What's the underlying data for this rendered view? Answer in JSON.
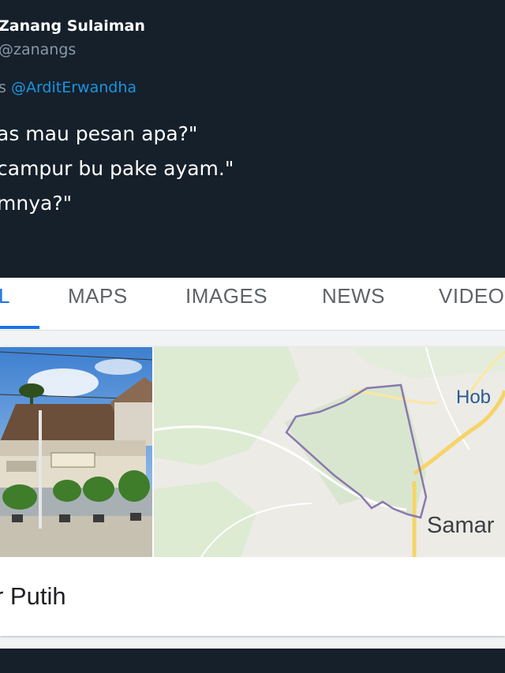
{
  "tweet": {
    "author_name": "Zanang Sulaiman",
    "author_handle": "@zanangs",
    "reply_prefix": "s ",
    "reply_mention": "@ArditErwandha",
    "text_lines": [
      "as mau pesan apa?\"",
      "campur bu pake ayam.\"",
      "mnya?\""
    ]
  },
  "search_tabs": {
    "tabs": [
      {
        "label": "L",
        "active": true
      },
      {
        "label": "MAPS",
        "active": false
      },
      {
        "label": "IMAGES",
        "active": false
      },
      {
        "label": "NEWS",
        "active": false
      },
      {
        "label": "VIDEOS",
        "active": false
      }
    ],
    "accent_color": "#1a73e8"
  },
  "result_card": {
    "map_labels": {
      "top_right": "Hob",
      "bottom_right": "Samar"
    },
    "place_title": "r Putih"
  },
  "colors": {
    "tweet_background": "#15202b",
    "mention_link": "#1b95e0",
    "handle_gray": "#8899a6"
  }
}
